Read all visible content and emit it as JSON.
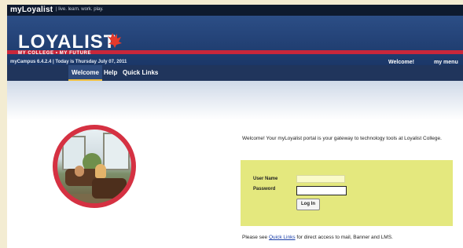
{
  "topbar": {
    "brand": "myLoyalist",
    "tagline": "| live. learn. work. play."
  },
  "header": {
    "logo": "LOYALIST",
    "motto": "MY COLLEGE • MY FUTURE",
    "info": "myCampus 6.4.2.4 | Today is Thursday July 07, 2011",
    "welcome": "Welcome!",
    "menu": "my menu"
  },
  "nav": {
    "tabs": [
      {
        "label": "Welcome"
      },
      {
        "label": "Help"
      },
      {
        "label": "Quick Links"
      }
    ]
  },
  "main": {
    "intro": "Welcome!  Your myLoyalist portal is your gateway to technology tools at Loyalist College.",
    "login": {
      "user_label": "User Name",
      "password_label": "Password",
      "user_value": "",
      "password_value": "",
      "button": "Log In"
    },
    "quick_prefix": "Please see ",
    "quick_link": "Quick Links",
    "quick_suffix": " for direct access to mail, Banner and LMS."
  },
  "colors": {
    "accent_red": "#c9273b",
    "header_blue": "#1b3768",
    "login_bg": "#e4e87e"
  }
}
